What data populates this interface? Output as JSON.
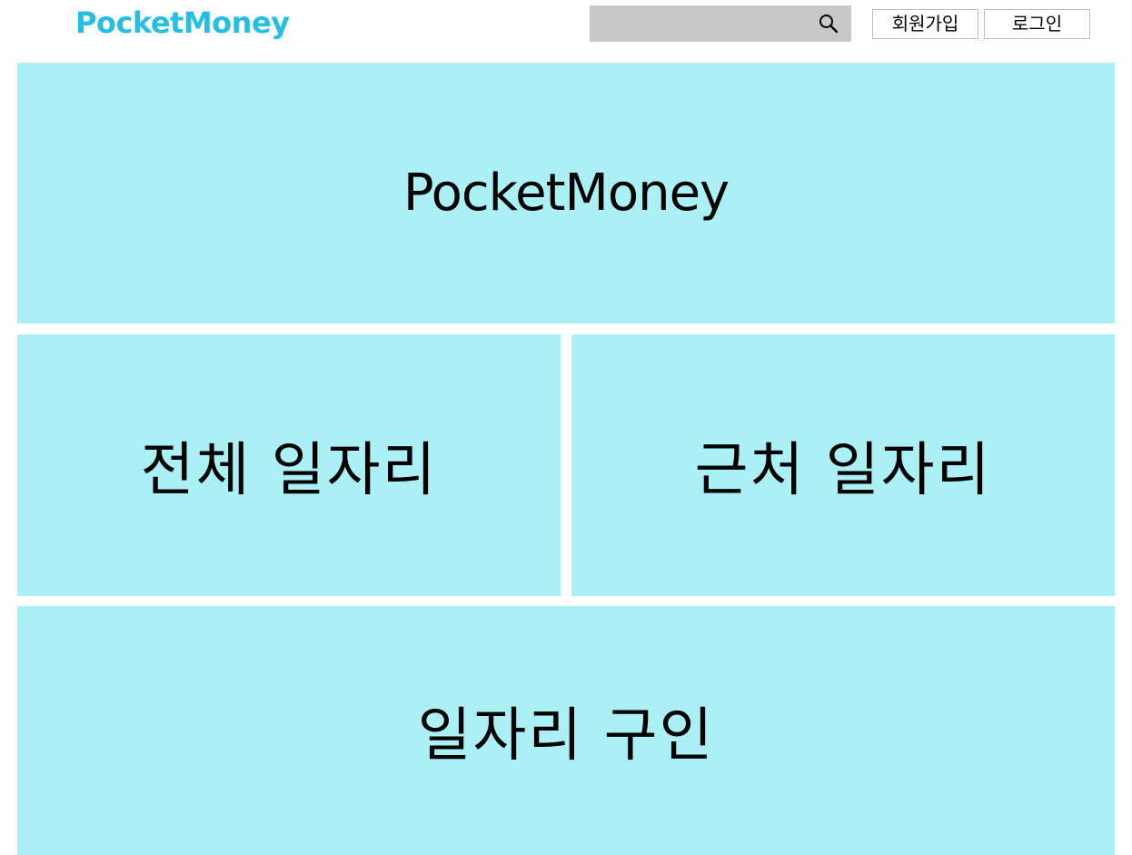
{
  "header": {
    "logo": "PocketMoney",
    "search": {
      "placeholder": "",
      "value": "",
      "icon": "search-icon"
    },
    "signup_label": "회원가입",
    "login_label": "로그인"
  },
  "main": {
    "banner_title": "PocketMoney",
    "tiles": [
      {
        "label": "전체 일자리"
      },
      {
        "label": "근처 일자리"
      },
      {
        "label": "일자리 구인"
      }
    ]
  },
  "colors": {
    "brand": "#24bfe3",
    "tile_bg": "#aaf0f5",
    "search_bg": "#c8c8c8"
  }
}
